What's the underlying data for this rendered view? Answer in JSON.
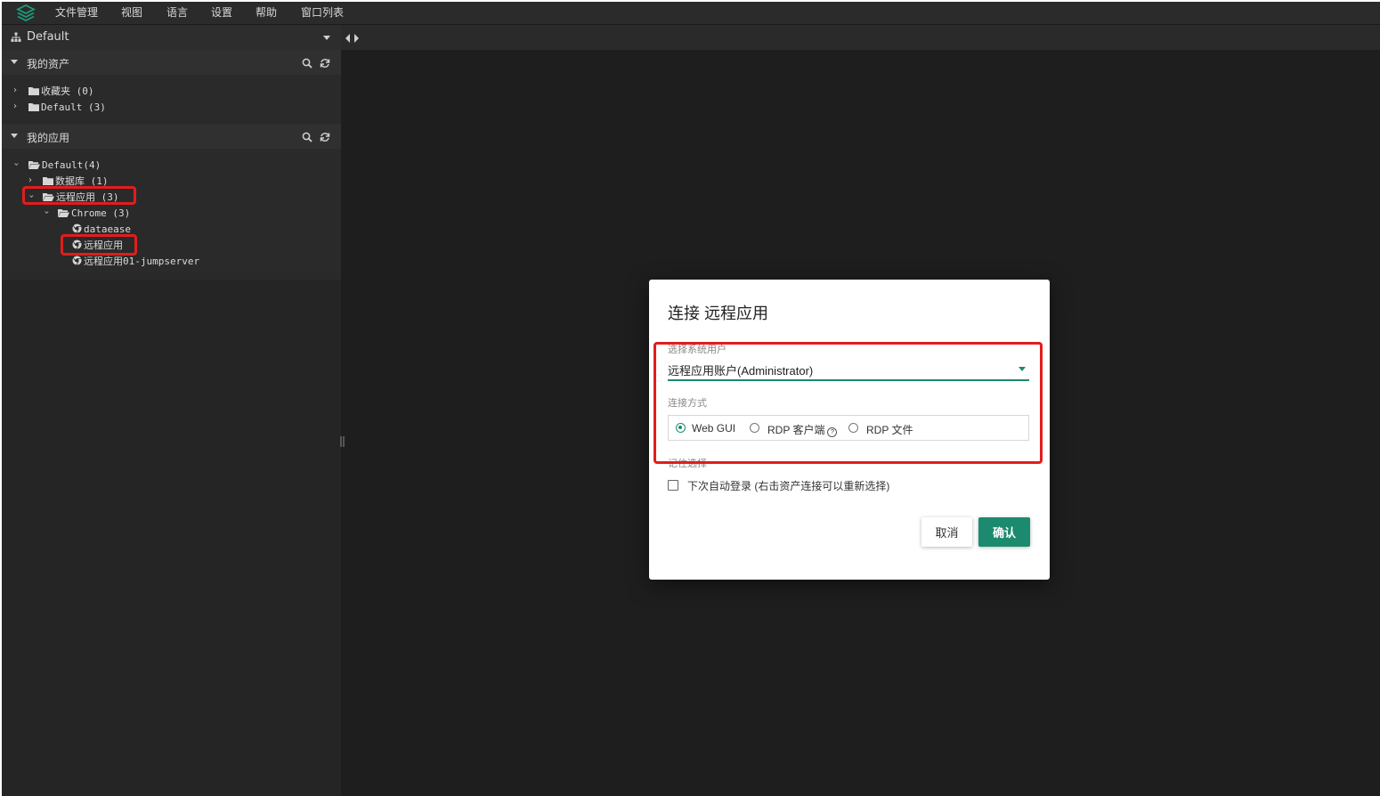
{
  "menubar": {
    "items": [
      "文件管理",
      "视图",
      "语言",
      "设置",
      "帮助",
      "窗口列表"
    ]
  },
  "sidebar": {
    "profile": "Default",
    "sections": [
      {
        "title": "我的资产",
        "nodes": [
          "收藏夹 (0)",
          "Default (3)"
        ]
      },
      {
        "title": "我的应用",
        "nodes": [
          "Default(4)",
          "数据库 (1)",
          "远程应用 (3)",
          "Chrome (3)",
          "dataease",
          "远程应用",
          "远程应用01-jumpserver"
        ]
      }
    ]
  },
  "dialog": {
    "title": "连接 远程应用",
    "user_label": "选择系统用户",
    "user_value": "远程应用账户(Administrator)",
    "connect_label": "连接方式",
    "options": [
      "Web GUI",
      "RDP 客户端",
      "RDP 文件"
    ],
    "selected_option": "Web GUI",
    "remember_label": "记住选择",
    "auto_login_label": "下次自动登录 (右击资产连接可以重新选择)",
    "cancel": "取消",
    "confirm": "确认"
  },
  "colors": {
    "accent": "#1c8a6e",
    "highlight": "#e11d1d",
    "sidebar_bg": "#252526",
    "main_bg": "#1e1e1e"
  }
}
